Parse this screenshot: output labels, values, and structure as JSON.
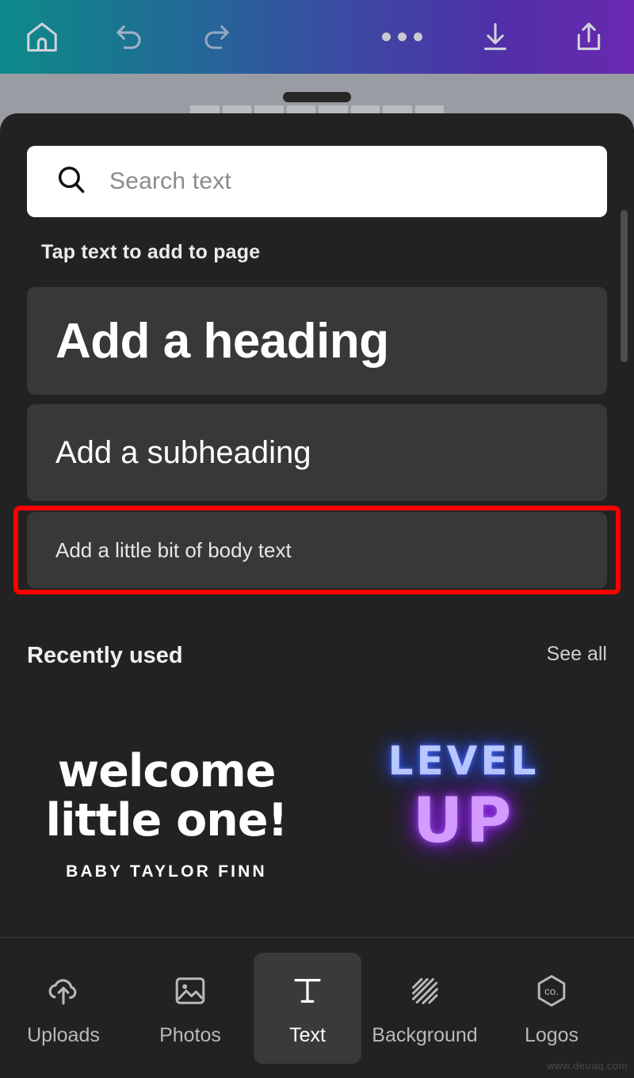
{
  "toolbar": {
    "home_label": "Home",
    "undo_label": "Undo",
    "redo_label": "Redo",
    "more_label": "More",
    "download_label": "Download",
    "share_label": "Share",
    "gradient_start": "#0d8a8a",
    "gradient_end": "#6a28b0"
  },
  "search": {
    "placeholder": "Search text",
    "value": ""
  },
  "panel": {
    "section_label": "Tap text to add to page",
    "cards": [
      {
        "text": "Add a heading"
      },
      {
        "text": "Add a subheading"
      },
      {
        "text": "Add a little bit of body text"
      }
    ],
    "highlight_color": "#ff0000",
    "highlighted_card_index": 2
  },
  "recently_used": {
    "title": "Recently used",
    "see_all_label": "See all",
    "items": [
      {
        "line1": "welcome",
        "line2": "little one!",
        "subtitle": "BABY TAYLOR FINN"
      },
      {
        "line1": "LEVEL",
        "line2": "UP",
        "subtitle": ""
      }
    ]
  },
  "bottom_nav": {
    "items": [
      {
        "label": "Uploads",
        "icon": "cloud-upload-icon",
        "active": false
      },
      {
        "label": "Photos",
        "icon": "image-icon",
        "active": false
      },
      {
        "label": "Text",
        "icon": "text-t-icon",
        "active": true
      },
      {
        "label": "Background",
        "icon": "stripes-icon",
        "active": false
      },
      {
        "label": "Logos",
        "icon": "hexagon-co-icon",
        "active": false
      }
    ]
  },
  "watermark": {
    "text": "www.deuaq.com"
  }
}
